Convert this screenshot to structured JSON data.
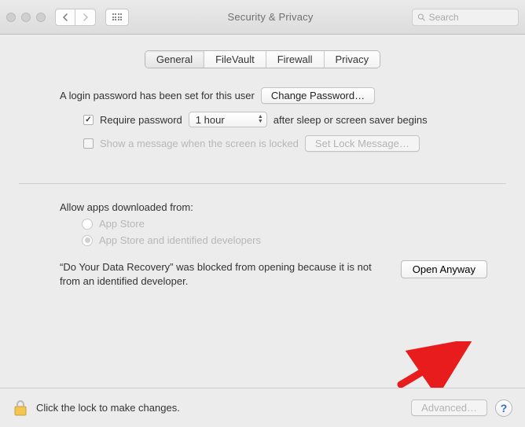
{
  "window": {
    "title": "Security & Privacy",
    "search_placeholder": "Search"
  },
  "tabs": {
    "general": "General",
    "filevault": "FileVault",
    "firewall": "Firewall",
    "privacy": "Privacy"
  },
  "login": {
    "password_set_text": "A login password has been set for this user",
    "change_password_btn": "Change Password…",
    "require_password_label": "Require password",
    "require_password_delay": "1 hour",
    "after_sleep_text": "after sleep or screen saver begins",
    "show_message_label": "Show a message when the screen is locked",
    "set_lock_message_btn": "Set Lock Message…"
  },
  "allow_apps": {
    "heading": "Allow apps downloaded from:",
    "option_appstore": "App Store",
    "option_identified": "App Store and identified developers"
  },
  "blocked": {
    "message": "“Do Your Data Recovery” was blocked from opening because it is not from an identified developer.",
    "open_anyway_btn": "Open Anyway"
  },
  "footer": {
    "lock_text": "Click the lock to make changes.",
    "advanced_btn": "Advanced…",
    "help_btn": "?"
  }
}
